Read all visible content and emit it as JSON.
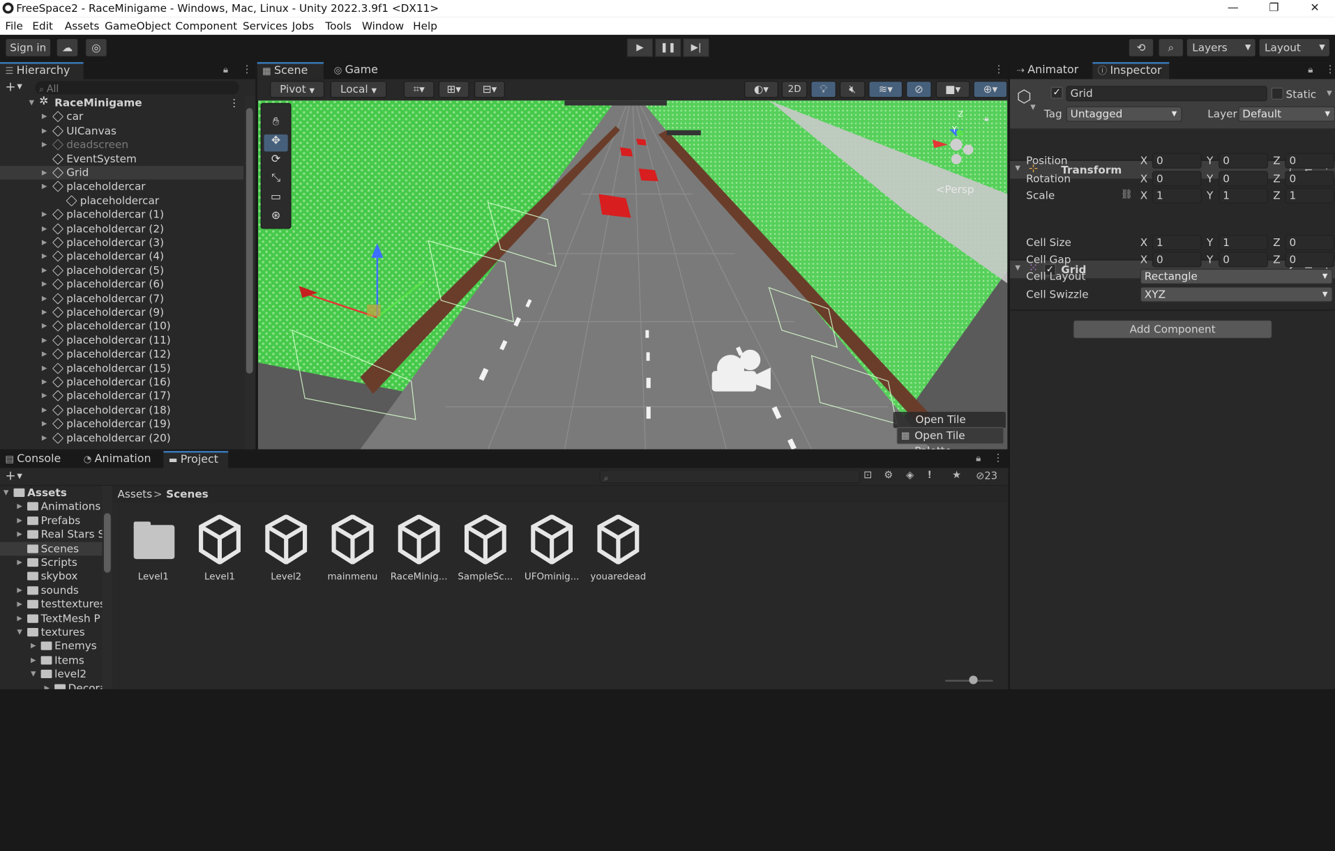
{
  "window": {
    "title": "FreeSpace2 - RaceMinigame - Windows, Mac, Linux - Unity 2022.3.9f1 <DX11>"
  },
  "menu": [
    "File",
    "Edit",
    "Assets",
    "GameObject",
    "Component",
    "Services",
    "Jobs",
    "Tools",
    "Window",
    "Help"
  ],
  "toolbar": {
    "sign_in": "Sign in",
    "layers": "Layers",
    "layout": "Layout"
  },
  "hierarchy": {
    "tab": "Hierarchy",
    "search_placeholder": "All",
    "scene_name": "RaceMinigame",
    "items": [
      {
        "label": "car",
        "dim": false
      },
      {
        "label": "UICanvas",
        "dim": false
      },
      {
        "label": "deadscreen",
        "dim": true
      },
      {
        "label": "EventSystem",
        "dim": false
      },
      {
        "label": "Grid",
        "dim": false
      },
      {
        "label": "placeholdercar",
        "dim": false
      },
      {
        "label": "placeholdercar",
        "dim": false
      },
      {
        "label": "placeholdercar (1)",
        "dim": false
      },
      {
        "label": "placeholdercar (2)",
        "dim": false
      },
      {
        "label": "placeholdercar (3)",
        "dim": false
      },
      {
        "label": "placeholdercar (4)",
        "dim": false
      },
      {
        "label": "placeholdercar (5)",
        "dim": false
      },
      {
        "label": "placeholdercar (6)",
        "dim": false
      },
      {
        "label": "placeholdercar (7)",
        "dim": false
      },
      {
        "label": "placeholdercar (9)",
        "dim": false
      },
      {
        "label": "placeholdercar (10)",
        "dim": false
      },
      {
        "label": "placeholdercar (11)",
        "dim": false
      },
      {
        "label": "placeholdercar (12)",
        "dim": false
      },
      {
        "label": "placeholdercar (15)",
        "dim": false
      },
      {
        "label": "placeholdercar (16)",
        "dim": false
      },
      {
        "label": "placeholdercar (17)",
        "dim": false
      },
      {
        "label": "placeholdercar (18)",
        "dim": false
      },
      {
        "label": "placeholdercar (19)",
        "dim": false
      },
      {
        "label": "placeholdercar (20)",
        "dim": false
      }
    ]
  },
  "scene": {
    "tabs": [
      "Scene",
      "Game"
    ],
    "pivot": "Pivot",
    "local": "Local",
    "mode_2d": "2D",
    "persp": "Persp",
    "tile_palette_1": "Open Tile Palette",
    "tile_palette_2": "Open Tile Palette",
    "gizmo_y": "Y",
    "gizmo_z": "Z"
  },
  "inspector": {
    "tabs": [
      "Animator",
      "Inspector"
    ],
    "object_name": "Grid",
    "static_label": "Static",
    "tag_label": "Tag",
    "tag_value": "Untagged",
    "layer_label": "Layer",
    "layer_value": "Default",
    "transform": {
      "title": "Transform",
      "rows": [
        {
          "label": "Position",
          "x": "0",
          "y": "0",
          "z": "0"
        },
        {
          "label": "Rotation",
          "x": "0",
          "y": "0",
          "z": "0"
        },
        {
          "label": "Scale",
          "x": "1",
          "y": "1",
          "z": "1"
        }
      ]
    },
    "grid": {
      "title": "Grid",
      "cell_size_label": "Cell Size",
      "cell_size": {
        "x": "1",
        "y": "1",
        "z": "0"
      },
      "cell_gap_label": "Cell Gap",
      "cell_gap": {
        "x": "0",
        "y": "0",
        "z": "0"
      },
      "cell_layout_label": "Cell Layout",
      "cell_layout": "Rectangle",
      "cell_swizzle_label": "Cell Swizzle",
      "cell_swizzle": "XYZ"
    },
    "add_component": "Add Component",
    "axis_x": "X",
    "axis_y": "Y",
    "axis_z": "Z"
  },
  "bottom": {
    "tabs": [
      "Console",
      "Animation",
      "Project"
    ],
    "badge_count": "23",
    "breadcrumb_root": "Assets",
    "breadcrumb_sep": ">",
    "breadcrumb_current": "Scenes",
    "tree": [
      {
        "label": "Assets",
        "bold": true
      },
      {
        "label": "Animations"
      },
      {
        "label": "Prefabs"
      },
      {
        "label": "Real Stars S"
      },
      {
        "label": "Scenes"
      },
      {
        "label": "Scripts"
      },
      {
        "label": "skybox"
      },
      {
        "label": "sounds"
      },
      {
        "label": "testtextures"
      },
      {
        "label": "TextMesh P"
      },
      {
        "label": "textures"
      },
      {
        "label": "Enemys"
      },
      {
        "label": "Items"
      },
      {
        "label": "level2"
      },
      {
        "label": "Decora"
      }
    ],
    "assets": [
      "Level1",
      "Level1",
      "Level2",
      "mainmenu",
      "RaceMinig...",
      "SampleSc...",
      "UFOminig...",
      "youaredead"
    ]
  }
}
